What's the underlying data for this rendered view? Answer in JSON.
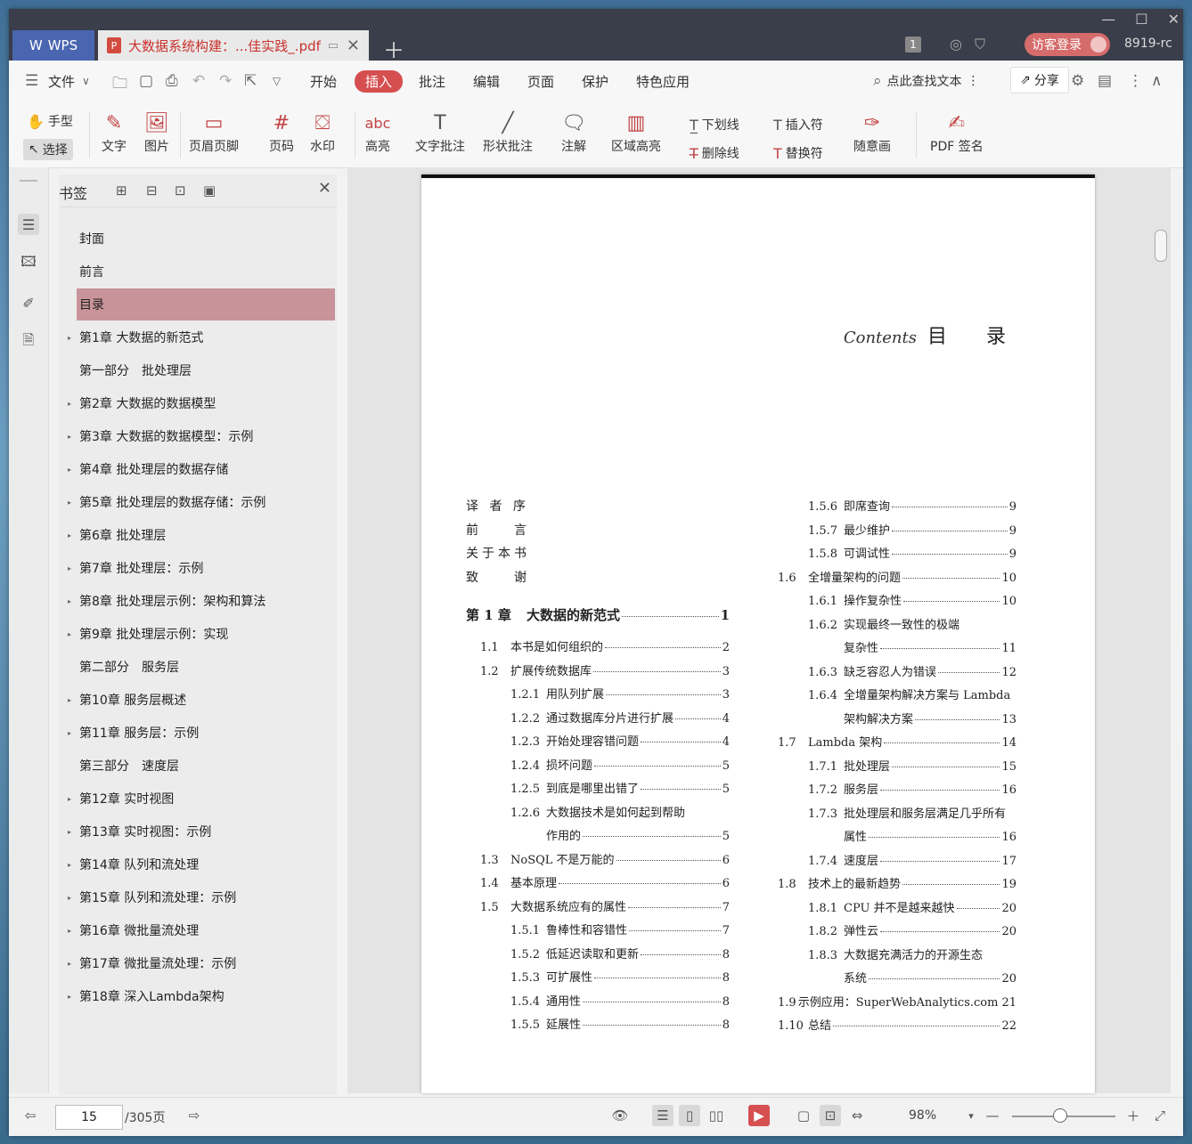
{
  "titlebar": {
    "app_tab": "WPS",
    "doc_tab": "大数据系统构建：...佳实践_.pdf",
    "tab_count": "1",
    "login": "访客登录",
    "account": "8919-rc"
  },
  "menu": {
    "file": "文件",
    "items": [
      "开始",
      "插入",
      "批注",
      "编辑",
      "页面",
      "保护",
      "特色应用"
    ],
    "active": "插入",
    "search": "点此查找文本",
    "share": "分享"
  },
  "ribbon": {
    "hand": "手型",
    "select": "选择",
    "text": "文字",
    "image": "图片",
    "header_footer": "页眉页脚",
    "page_num": "页码",
    "watermark": "水印",
    "highlight": "高亮",
    "text_comment": "文字批注",
    "shape_comment": "形状批注",
    "note": "注解",
    "area_highlight": "区域高亮",
    "underline": "下划线",
    "strikethrough": "删除线",
    "insert_char": "插入符",
    "replace_char": "替换符",
    "freehand": "随意画",
    "pdf_sign": "PDF 签名"
  },
  "bookmarks": {
    "title": "书签",
    "items": [
      {
        "label": "封面",
        "expand": false,
        "selected": false
      },
      {
        "label": "前言",
        "expand": false,
        "selected": false
      },
      {
        "label": "目录",
        "expand": false,
        "selected": true
      },
      {
        "label": "第1章 大数据的新范式",
        "expand": true,
        "selected": false
      },
      {
        "label": "第一部分　批处理层",
        "expand": false,
        "selected": false
      },
      {
        "label": "第2章 大数据的数据模型",
        "expand": true,
        "selected": false
      },
      {
        "label": "第3章 大数据的数据模型：示例",
        "expand": true,
        "selected": false
      },
      {
        "label": "第4章 批处理层的数据存储",
        "expand": true,
        "selected": false
      },
      {
        "label": "第5章 批处理层的数据存储：示例",
        "expand": true,
        "selected": false
      },
      {
        "label": "第6章 批处理层",
        "expand": true,
        "selected": false
      },
      {
        "label": "第7章 批处理层：示例",
        "expand": true,
        "selected": false
      },
      {
        "label": "第8章 批处理层示例：架构和算法",
        "expand": true,
        "selected": false
      },
      {
        "label": "第9章 批处理层示例：实现",
        "expand": true,
        "selected": false
      },
      {
        "label": "第二部分　服务层",
        "expand": false,
        "selected": false
      },
      {
        "label": "第10章 服务层概述",
        "expand": true,
        "selected": false
      },
      {
        "label": "第11章 服务层：示例",
        "expand": true,
        "selected": false
      },
      {
        "label": "第三部分　速度层",
        "expand": false,
        "selected": false
      },
      {
        "label": "第12章 实时视图",
        "expand": true,
        "selected": false
      },
      {
        "label": "第13章 实时视图：示例",
        "expand": true,
        "selected": false
      },
      {
        "label": "第14章 队列和流处理",
        "expand": true,
        "selected": false
      },
      {
        "label": "第15章 队列和流处理：示例",
        "expand": true,
        "selected": false
      },
      {
        "label": "第16章 微批量流处理",
        "expand": true,
        "selected": false
      },
      {
        "label": "第17章 微批量流处理：示例",
        "expand": true,
        "selected": false
      },
      {
        "label": "第18章 深入Lambda架构",
        "expand": true,
        "selected": false
      }
    ]
  },
  "page": {
    "contents_script": "Contents",
    "contents_title": "目　　录",
    "front_matter": [
      "译 者 序",
      "前　　言",
      "关于本书",
      "致　　谢"
    ],
    "left_col": [
      {
        "num": "第 1 章",
        "title": "大数据的新范式",
        "page": "1",
        "level": 0
      },
      {
        "num": "1.1",
        "title": "本书是如何组织的",
        "page": "2",
        "level": 1
      },
      {
        "num": "1.2",
        "title": "扩展传统数据库",
        "page": "3",
        "level": 1
      },
      {
        "num": "1.2.1",
        "title": "用队列扩展",
        "page": "3",
        "level": 2
      },
      {
        "num": "1.2.2",
        "title": "通过数据库分片进行扩展",
        "page": "4",
        "level": 2
      },
      {
        "num": "1.2.3",
        "title": "开始处理容错问题",
        "page": "4",
        "level": 2
      },
      {
        "num": "1.2.4",
        "title": "损坏问题",
        "page": "5",
        "level": 2
      },
      {
        "num": "1.2.5",
        "title": "到底是哪里出错了",
        "page": "5",
        "level": 2
      },
      {
        "num": "1.2.6",
        "title": "大数据技术是如何起到帮助",
        "page": "",
        "level": 2
      },
      {
        "num": "",
        "title": "作用的",
        "page": "5",
        "level": 3
      },
      {
        "num": "1.3",
        "title": "NoSQL 不是万能的",
        "page": "6",
        "level": 1
      },
      {
        "num": "1.4",
        "title": "基本原理",
        "page": "6",
        "level": 1
      },
      {
        "num": "1.5",
        "title": "大数据系统应有的属性",
        "page": "7",
        "level": 1
      },
      {
        "num": "1.5.1",
        "title": "鲁棒性和容错性",
        "page": "7",
        "level": 2
      },
      {
        "num": "1.5.2",
        "title": "低延迟读取和更新",
        "page": "8",
        "level": 2
      },
      {
        "num": "1.5.3",
        "title": "可扩展性",
        "page": "8",
        "level": 2
      },
      {
        "num": "1.5.4",
        "title": "通用性",
        "page": "8",
        "level": 2
      },
      {
        "num": "1.5.5",
        "title": "延展性",
        "page": "8",
        "level": 2
      }
    ],
    "right_col": [
      {
        "num": "1.5.6",
        "title": "即席查询",
        "page": "9",
        "level": 2
      },
      {
        "num": "1.5.7",
        "title": "最少维护",
        "page": "9",
        "level": 2
      },
      {
        "num": "1.5.8",
        "title": "可调试性",
        "page": "9",
        "level": 2
      },
      {
        "num": "1.6",
        "title": "全增量架构的问题",
        "page": "10",
        "level": 1
      },
      {
        "num": "1.6.1",
        "title": "操作复杂性",
        "page": "10",
        "level": 2
      },
      {
        "num": "1.6.2",
        "title": "实现最终一致性的极端",
        "page": "",
        "level": 2
      },
      {
        "num": "",
        "title": "复杂性",
        "page": "11",
        "level": 3
      },
      {
        "num": "1.6.3",
        "title": "缺乏容忍人为错误",
        "page": "12",
        "level": 2
      },
      {
        "num": "1.6.4",
        "title": "全增量架构解决方案与 Lambda",
        "page": "",
        "level": 2
      },
      {
        "num": "",
        "title": "架构解决方案",
        "page": "13",
        "level": 3
      },
      {
        "num": "1.7",
        "title": "Lambda 架构",
        "page": "14",
        "level": 1
      },
      {
        "num": "1.7.1",
        "title": "批处理层",
        "page": "15",
        "level": 2
      },
      {
        "num": "1.7.2",
        "title": "服务层",
        "page": "16",
        "level": 2
      },
      {
        "num": "1.7.3",
        "title": "批处理层和服务层满足几乎所有",
        "page": "",
        "level": 2
      },
      {
        "num": "",
        "title": "属性",
        "page": "16",
        "level": 3
      },
      {
        "num": "1.7.4",
        "title": "速度层",
        "page": "17",
        "level": 2
      },
      {
        "num": "1.8",
        "title": "技术上的最新趋势",
        "page": "19",
        "level": 1
      },
      {
        "num": "1.8.1",
        "title": "CPU 并不是越来越快",
        "page": "20",
        "level": 2
      },
      {
        "num": "1.8.2",
        "title": "弹性云",
        "page": "20",
        "level": 2
      },
      {
        "num": "1.8.3",
        "title": "大数据充满活力的开源生态",
        "page": "",
        "level": 2
      },
      {
        "num": "",
        "title": "系统",
        "page": "20",
        "level": 3
      },
      {
        "num": "1.9",
        "title": "示例应用：SuperWebAnalytics.com",
        "page": "21",
        "level": 1
      },
      {
        "num": "1.10",
        "title": "总结",
        "page": "22",
        "level": 1
      }
    ]
  },
  "status": {
    "current_page": "15",
    "total_pages": "/305页",
    "zoom": "98%"
  },
  "colors": {
    "accent": "#d64f50",
    "bookmark_selected": "#c9939a"
  }
}
